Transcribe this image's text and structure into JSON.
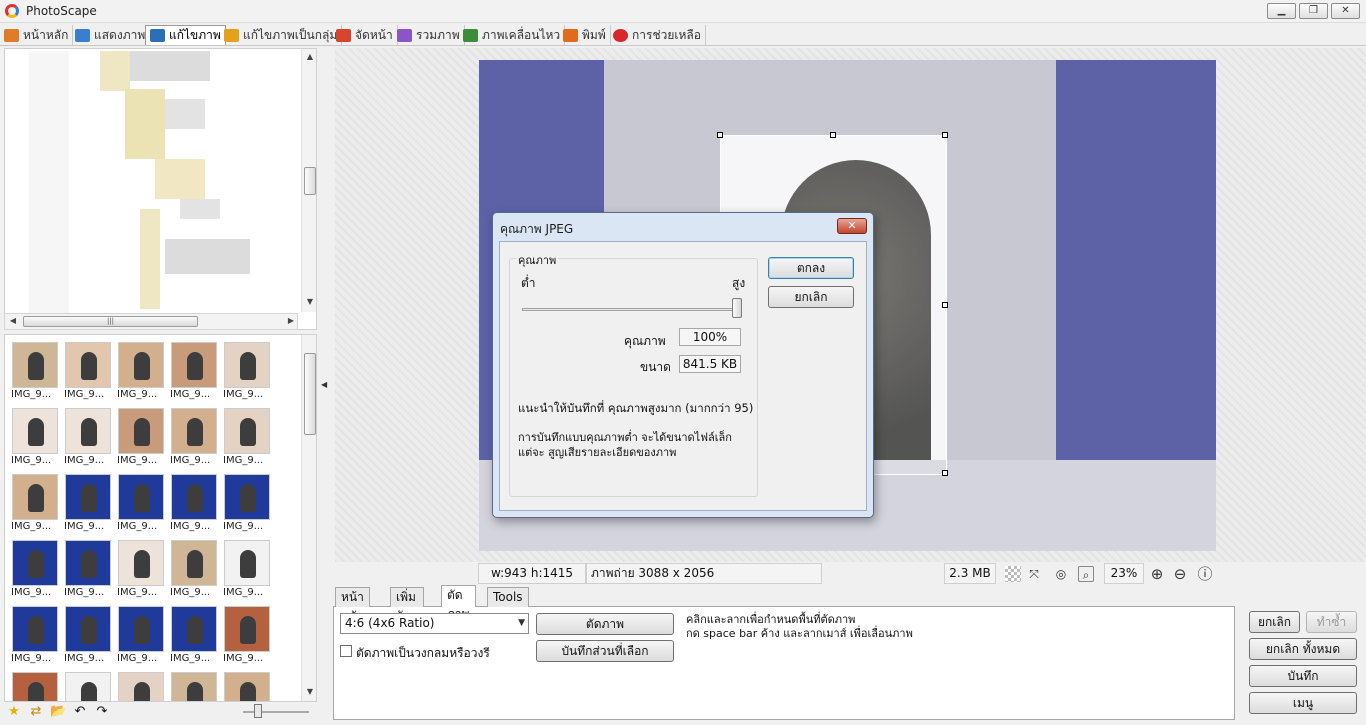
{
  "window": {
    "title": "PhotoScape",
    "controls": {
      "minimize": "▁",
      "restore": "❐",
      "close": "✕"
    }
  },
  "main_tabs": [
    {
      "label": "หน้าหลัก",
      "icon": "home-icon",
      "color": "#e07b2a"
    },
    {
      "label": "แสดงภาพ",
      "icon": "viewer-icon",
      "color": "#3a7ed0"
    },
    {
      "label": "แก้ไขภาพ",
      "icon": "editor-icon",
      "color": "#2c6fb7"
    },
    {
      "label": "แก้ไขภาพเป็นกลุ่ม",
      "icon": "batch-icon",
      "color": "#e3a21a"
    },
    {
      "label": "จัดหน้า",
      "icon": "page-icon",
      "color": "#d9442f"
    },
    {
      "label": "รวมภาพ",
      "icon": "combine-icon",
      "color": "#8a55c7"
    },
    {
      "label": "ภาพเคลื่อนไหว",
      "icon": "gif-icon",
      "color": "#3b8c3b"
    },
    {
      "label": "พิมพ์",
      "icon": "print-icon",
      "color": "#e06b1e"
    },
    {
      "label": "การช่วยเหลือ",
      "icon": "help-icon",
      "color": "#d8262b"
    }
  ],
  "scroll": {
    "thumb_grip": "|||"
  },
  "thumbnails": {
    "caption": "IMG_9...",
    "rows": 6,
    "columns": 5
  },
  "bottom_left_tools": [
    "★",
    "⇄",
    "📂",
    "↶",
    "↷"
  ],
  "status": {
    "dimensions": "w:943 h:1415",
    "original": "ภาพถ่าย 3088 x 2056",
    "filesize": "2.3 MB",
    "zoom": "23%"
  },
  "status_icons": {
    "zoom_in": "⊕",
    "zoom_out": "⊖",
    "info": "ⓘ"
  },
  "edit_tabs": [
    {
      "label": "หน้าหลัก"
    },
    {
      "label": "เพิ่มวัตถุ"
    },
    {
      "label": "ตัดภาพ"
    },
    {
      "label": "Tools"
    }
  ],
  "crop_panel": {
    "ratio_value": "4:6 (4x6 Ratio)",
    "crop_button": "ตัดภาพ",
    "save_selection_button": "บันทึกส่วนที่เลือก",
    "round_checkbox_label": "ตัดภาพเป็นวงกลมหรือวงรี",
    "hint_line1": "คลิกและลากเพื่อกำหนดพื้นที่ตัดภาพ",
    "hint_line2": "กด space bar ค้าง และลากเมาส์ เพื่อเลื่อนภาพ"
  },
  "right_buttons": {
    "undo": "ยกเลิก",
    "redo": "ทำซ้ำ",
    "undo_all": "ยกเลิก ทั้งหมด",
    "save": "บันทึก",
    "menu": "เมนู"
  },
  "jpeg_dialog": {
    "title": "คุณภาพ JPEG",
    "close": "✕",
    "group_label": "คุณภาพ",
    "low_label": "ต่ำ",
    "high_label": "สูง",
    "quality_label": "คุณภาพ",
    "quality_value": "100%",
    "quality_fraction": 1.0,
    "size_label": "ขนาด",
    "size_value": "841.5 KB",
    "recommend_text": "แนะนำให้บันทึกที่ คุณภาพสูงมาก (มากกว่า 95)",
    "note_line1": "การบันทึกแบบคุณภาพต่ำ จะได้ขนาดไฟล์เล็ก",
    "note_line2": "แต่จะ สูญเสียรายละเอียดของภาพ",
    "ok_button": "ตกลง",
    "cancel_button": "ยกเลิก"
  }
}
